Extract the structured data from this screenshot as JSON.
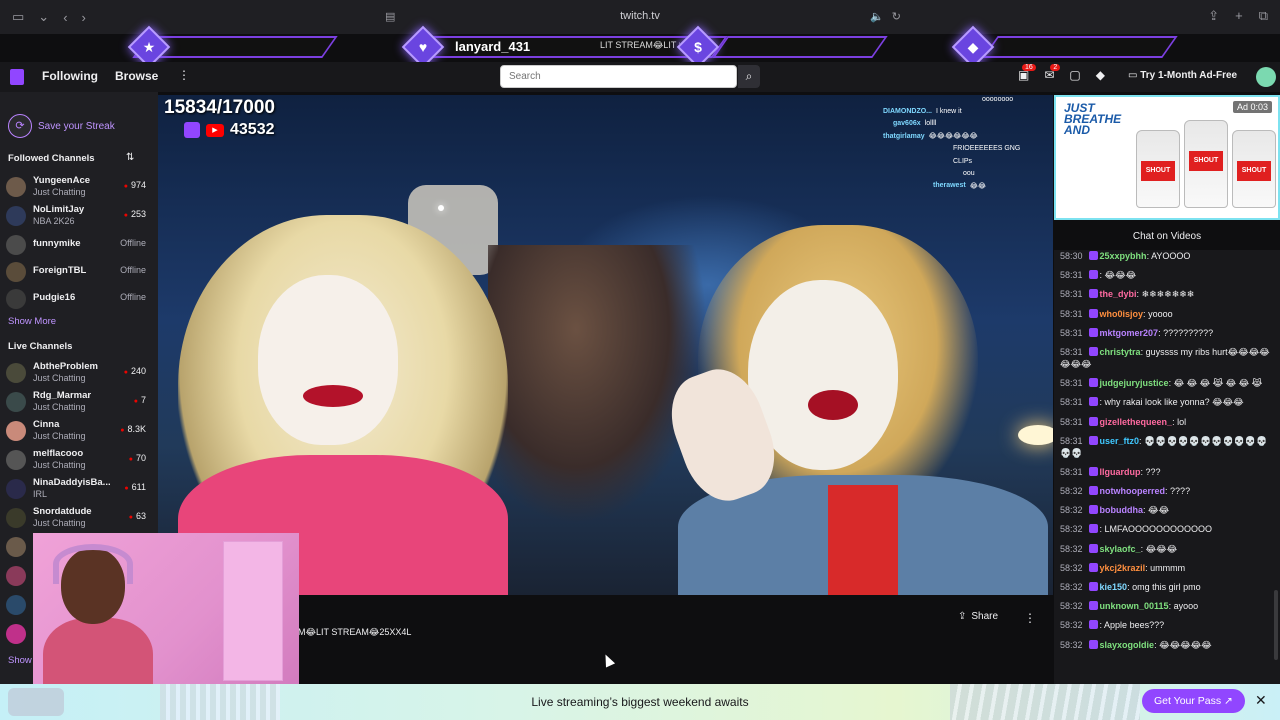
{
  "browser": {
    "url": "twitch.tv"
  },
  "overlay": {
    "username": "lanyard_431",
    "ticker": "LIT STREAM😂LIT S",
    "icons": [
      "star-icon",
      "heart-icon",
      "dollar-icon",
      "diamond-icon"
    ]
  },
  "nav": {
    "following": "Following",
    "browse": "Browse",
    "search_placeholder": "Search",
    "notif_badge_1": "16",
    "notif_badge_2": "2",
    "adfree": "Try 1-Month Ad-Free"
  },
  "sidebar": {
    "streak_label": "Save your Streak",
    "followed_title": "Followed Channels",
    "followed": [
      {
        "name": "YungeenAce",
        "category": "Just Chatting",
        "viewers": "974",
        "live": true
      },
      {
        "name": "NoLimitJay",
        "category": "NBA 2K26",
        "viewers": "253",
        "live": true
      },
      {
        "name": "funnymike",
        "category": "",
        "viewers": "Offline",
        "live": false
      },
      {
        "name": "ForeignTBL",
        "category": "",
        "viewers": "Offline",
        "live": false
      },
      {
        "name": "Pudgie16",
        "category": "",
        "viewers": "Offline",
        "live": false
      }
    ],
    "show_more": "Show More",
    "live_title": "Live Channels",
    "live": [
      {
        "name": "AbtheProblem",
        "category": "Just Chatting",
        "viewers": "240"
      },
      {
        "name": "Rdg_Marmar",
        "category": "Just Chatting",
        "viewers": "7"
      },
      {
        "name": "Cinna",
        "category": "Just Chatting",
        "viewers": "8.3K"
      },
      {
        "name": "melflacooo",
        "category": "Just Chatting",
        "viewers": "70"
      },
      {
        "name": "NinaDaddyisBa...",
        "category": "IRL",
        "viewers": "611"
      },
      {
        "name": "Snordatdude",
        "category": "Just Chatting",
        "viewers": "63"
      }
    ],
    "show_more_2": "Show"
  },
  "video": {
    "goal": "15834/17000",
    "viewer_count": "43532",
    "overlay_chat": [
      {
        "user": "",
        "msg": "oooooooo"
      },
      {
        "user": "DIAMONDZO...",
        "msg": "I knew it"
      },
      {
        "user": "gav606x",
        "msg": "lollll"
      },
      {
        "user": "thatgirlamay",
        "msg": "😂😂😂😂😂😂"
      },
      {
        "user": "",
        "msg": "FRIOEEEEEES GNG"
      },
      {
        "user": "",
        "msg": "CLIPs"
      },
      {
        "user": "",
        "msg": "oou"
      },
      {
        "user": "therawest",
        "msg": "😂😂"
      }
    ]
  },
  "info": {
    "title_ticker": "M😂LIT STREAM😂25XX4L",
    "share": "Share"
  },
  "ad": {
    "headline": "JUST BREATHE AND",
    "timer": "Ad 0:03",
    "brand": "SHOUT"
  },
  "chat": {
    "title": "Chat on Videos",
    "messages": [
      {
        "time": "58:30",
        "user": "25xxpybhh",
        "color": "#7fe07f",
        "msg": "AYOOOO"
      },
      {
        "time": "58:31",
        "user": "",
        "color": "#5a7aff",
        "msg": "😂😂😂"
      },
      {
        "time": "58:31",
        "user": "the_dybi",
        "color": "#ff6aa0",
        "msg": "❄❄❄❄❄❄❄"
      },
      {
        "time": "58:31",
        "user": "who0isjoy",
        "color": "#ff8f3f",
        "msg": "yoooo"
      },
      {
        "time": "58:31",
        "user": "mktgomer207",
        "color": "#b983ff",
        "msg": "??????????"
      },
      {
        "time": "58:31",
        "user": "christytra",
        "color": "#7fe07f",
        "msg": "guyssss my ribs hurt😂😂😂😂😂😂😂"
      },
      {
        "time": "58:31",
        "user": "judgejuryjustice",
        "color": "#7fe07f",
        "msg": "😂 😂 😂 😹 😂 😂 😹"
      },
      {
        "time": "58:31",
        "user": "",
        "color": "#ff3a3a",
        "msg": "why rakai look like yonna? 😂😂😂"
      },
      {
        "time": "58:31",
        "user": "gizellethequeen_",
        "color": "#ff6aa0",
        "msg": "lol"
      },
      {
        "time": "58:31",
        "user": "user_ftz0",
        "color": "#3fc8ff",
        "msg": "💀💀💀💀💀💀💀💀💀💀💀💀💀"
      },
      {
        "time": "58:31",
        "user": "llguardup",
        "color": "#ff6aa0",
        "msg": "???"
      },
      {
        "time": "58:32",
        "user": "notwhooperred",
        "color": "#b983ff",
        "msg": "????"
      },
      {
        "time": "58:32",
        "user": "bobuddha",
        "color": "#b983ff",
        "msg": "😂😂"
      },
      {
        "time": "58:32",
        "user": "",
        "color": "#5a7aff",
        "msg": "LMFAOOOOOOOOOOOO"
      },
      {
        "time": "58:32",
        "user": "skylaofc_",
        "color": "#7fe07f",
        "msg": "😂😂😂"
      },
      {
        "time": "58:32",
        "user": "ykcj2krazil",
        "color": "#ff8f3f",
        "msg": "ummmm"
      },
      {
        "time": "58:32",
        "user": "kie150",
        "color": "#7fd8ff",
        "msg": "omg this girl pmo"
      },
      {
        "time": "58:32",
        "user": "unknown_00115",
        "color": "#7fe07f",
        "msg": "ayooo"
      },
      {
        "time": "58:32",
        "user": "",
        "color": "#ff3a3a",
        "msg": "Apple bees???"
      },
      {
        "time": "58:32",
        "user": "slayxogoldie",
        "color": "#7fe07f",
        "msg": "😂😂😂😂😂"
      }
    ]
  },
  "promo": {
    "text": "Live streaming’s biggest weekend awaits",
    "button": "Get Your Pass ↗"
  }
}
